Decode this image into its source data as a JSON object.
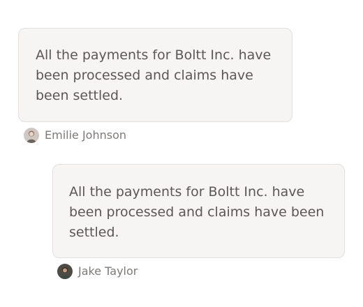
{
  "messages": [
    {
      "text": "All the payments for Boltt Inc. have been processed and claims have been settled.",
      "author": "Emilie Johnson"
    },
    {
      "text": "All the payments for Boltt Inc. have been processed and claims have been settled.",
      "author": "Jake Taylor"
    }
  ],
  "colors": {
    "bubble_background": "#f6f5f3",
    "bubble_border": "#e2e0df",
    "message_text": "#5b5754",
    "author_text": "#7d7a78"
  }
}
